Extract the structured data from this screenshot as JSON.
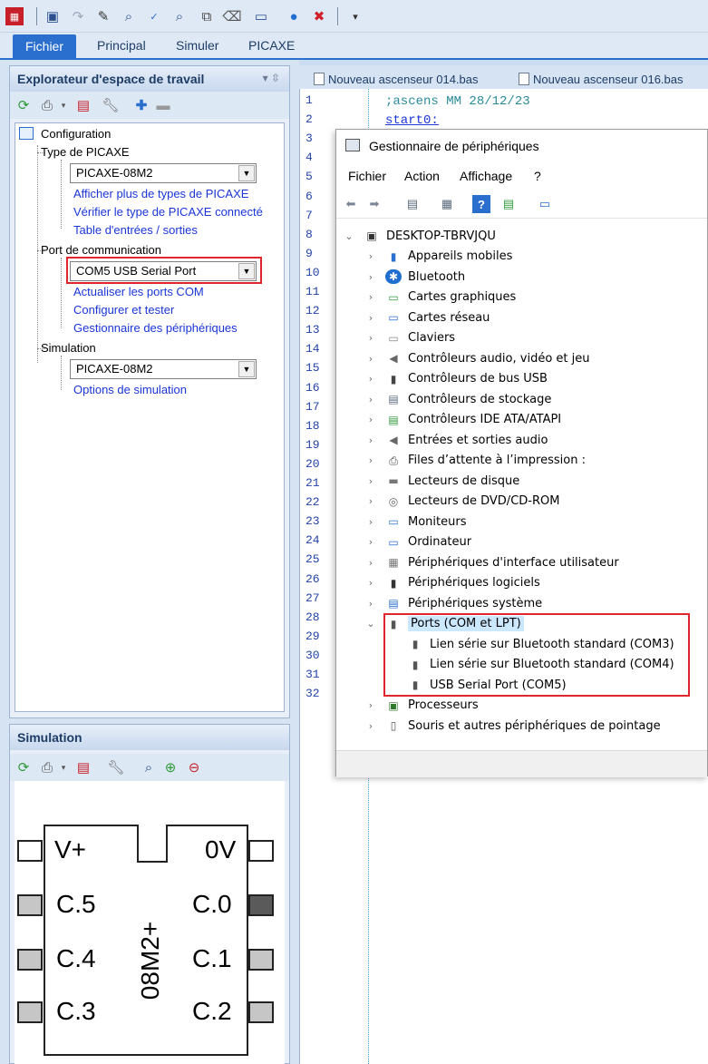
{
  "toolbar": {
    "icons": [
      "app-logo-icon",
      "save-icon",
      "redo-icon",
      "pencil-icon",
      "search-icon",
      "spellcheck-icon",
      "find-icon",
      "copy-icon",
      "eraser-icon",
      "program-icon",
      "run-icon",
      "stop-icon",
      "dropdown-icon"
    ]
  },
  "ribbon": {
    "tabs": [
      "Fichier",
      "Principal",
      "Simuler",
      "PICAXE"
    ]
  },
  "explorer": {
    "title": "Explorateur d'espace de travail",
    "pin_glyph": "▾  ⇳",
    "root": "Configuration",
    "type_section": "Type de PICAXE",
    "type_value": "PICAXE-08M2",
    "type_links": [
      "Afficher plus de types de PICAXE",
      "Vérifier le type de PICAXE connecté",
      "Table d'entrées / sorties"
    ],
    "port_section": "Port de communication",
    "port_value": "COM5 USB Serial Port",
    "port_links": [
      "Actualiser les ports COM",
      "Configurer et tester",
      "Gestionnaire des périphériques"
    ],
    "sim_section": "Simulation",
    "sim_value": "PICAXE-08M2",
    "sim_links": [
      "Options de simulation"
    ]
  },
  "simulation": {
    "title": "Simulation",
    "chip": {
      "name": "08M2+",
      "left_pins": [
        "V+",
        "C.5",
        "C.4",
        "C.3"
      ],
      "right_pins": [
        "0V",
        "C.0",
        "C.1",
        "C.2"
      ]
    }
  },
  "editor": {
    "tabs": [
      "Nouveau ascenseur 014.bas",
      "Nouveau ascenseur 016.bas"
    ],
    "line_numbers": [
      "1",
      "2",
      "3",
      "4",
      "5",
      "6",
      "7",
      "8",
      "9",
      "10",
      "11",
      "12",
      "13",
      "14",
      "15",
      "16",
      "17",
      "18",
      "19",
      "20",
      "21",
      "22",
      "23",
      "24",
      "25",
      "26",
      "27",
      "28",
      "29",
      "30",
      "31",
      "32"
    ],
    "line1": ";ascens MM 28/12/23",
    "line2": "start0:",
    "comment_color": "#2a8a9a",
    "label_color": "#1a35d8"
  },
  "device_manager": {
    "title": "Gestionnaire de périphériques",
    "menu": [
      "Fichier",
      "Action",
      "Affichage",
      "?"
    ],
    "computer": "DESKTOP-TBRVJQU",
    "categories": [
      "Appareils mobiles",
      "Bluetooth",
      "Cartes graphiques",
      "Cartes réseau",
      "Claviers",
      "Contrôleurs audio, vidéo et jeu",
      "Contrôleurs de bus USB",
      "Contrôleurs de stockage",
      "Contrôleurs IDE ATA/ATAPI",
      "Entrées et sorties audio",
      "Files d’attente à l’impression :",
      "Lecteurs de disque",
      "Lecteurs de DVD/CD-ROM",
      "Moniteurs",
      "Ordinateur",
      "Périphériques d'interface utilisateur",
      "Périphériques logiciels",
      "Périphériques système"
    ],
    "ports_category": "Ports (COM et LPT)",
    "ports": [
      "Lien série sur Bluetooth standard (COM3)",
      "Lien série sur Bluetooth standard (COM4)",
      "USB Serial Port (COM5)"
    ],
    "after_ports": [
      "Processeurs",
      "Souris et autres périphériques de pointage"
    ],
    "highlight_color": "#e0262d",
    "selection_color": "#cce8ff"
  }
}
